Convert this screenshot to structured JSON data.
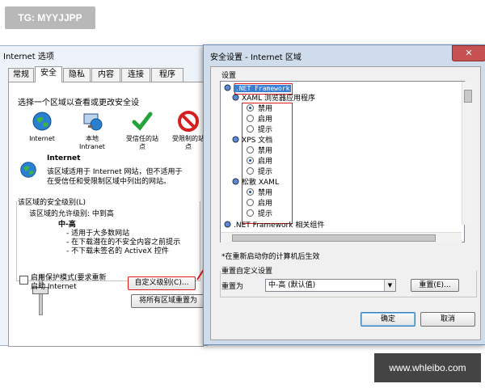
{
  "watermarks": {
    "top_left": "TG: MYYJJPP",
    "bottom_right": "www.whleibo.com"
  },
  "internet_options": {
    "title": "Internet 选项",
    "tabs": [
      {
        "label": "常规"
      },
      {
        "label": "安全"
      },
      {
        "label": "隐私"
      },
      {
        "label": "内容"
      },
      {
        "label": "连接"
      },
      {
        "label": "程序"
      }
    ],
    "select_zone_label": "选择一个区域以查看或更改安全设",
    "zones": [
      {
        "label": "Internet",
        "icon": "globe-icon"
      },
      {
        "label": "本地\nIntranet",
        "icon": "local-intranet-icon"
      },
      {
        "label": "受信任的站\n点",
        "icon": "trusted-check-icon"
      },
      {
        "label": "受限制的站\n点",
        "icon": "restricted-icon"
      }
    ],
    "zone_title": "Internet",
    "zone_desc": "该区域适用于 Internet 网站，但不适用于\n在受信任和受限制区域中列出的网站。",
    "security_level_group": "该区域的安全级别(L)",
    "allowed_level_text": "该区域的允许级别: 中到高",
    "current_level": "中-高",
    "level_bullets": [
      "- 适用于大多数网站",
      "- 在下载潜在的不安全内容之前提示",
      "- 不下载未签名的 ActiveX 控件"
    ],
    "protected_mode_label": "启用保护模式(要求重新\n启动 Internet",
    "custom_level_button": "自定义级别(C)...",
    "reset_all_button": "将所有区域重置为"
  },
  "security_settings": {
    "title": "安全设置 - Internet 区域",
    "settings_label": "设置",
    "close_icon": "close-icon",
    "tree": [
      {
        "kind": "group",
        "label": ".NET Framework",
        "highlight": true
      },
      {
        "kind": "item",
        "label": "XAML 浏览器应用程序"
      },
      {
        "kind": "option",
        "label": "禁用",
        "selected": true
      },
      {
        "kind": "option",
        "label": "启用",
        "selected": false
      },
      {
        "kind": "option",
        "label": "提示",
        "selected": false
      },
      {
        "kind": "item",
        "label": "XPS 文档"
      },
      {
        "kind": "option",
        "label": "禁用",
        "selected": false
      },
      {
        "kind": "option",
        "label": "启用",
        "selected": true
      },
      {
        "kind": "option",
        "label": "提示",
        "selected": false
      },
      {
        "kind": "item",
        "label": "松散 XAML"
      },
      {
        "kind": "option",
        "label": "禁用",
        "selected": true
      },
      {
        "kind": "option",
        "label": "启用",
        "selected": false
      },
      {
        "kind": "option",
        "label": "提示",
        "selected": false
      },
      {
        "kind": "group",
        "label": ".NET Framework 相关组件"
      }
    ],
    "restart_note": "*在重新启动你的计算机后生效",
    "reset_custom_label": "重置自定义设置",
    "reset_to_label": "重置为",
    "reset_to_value": "中-高 (默认值)",
    "reset_button": "重置(E)...",
    "ok_button": "确定",
    "cancel_button": "取消",
    "accent_highlight": "#3a7fd4",
    "annotation_color": "#e21b1b"
  }
}
